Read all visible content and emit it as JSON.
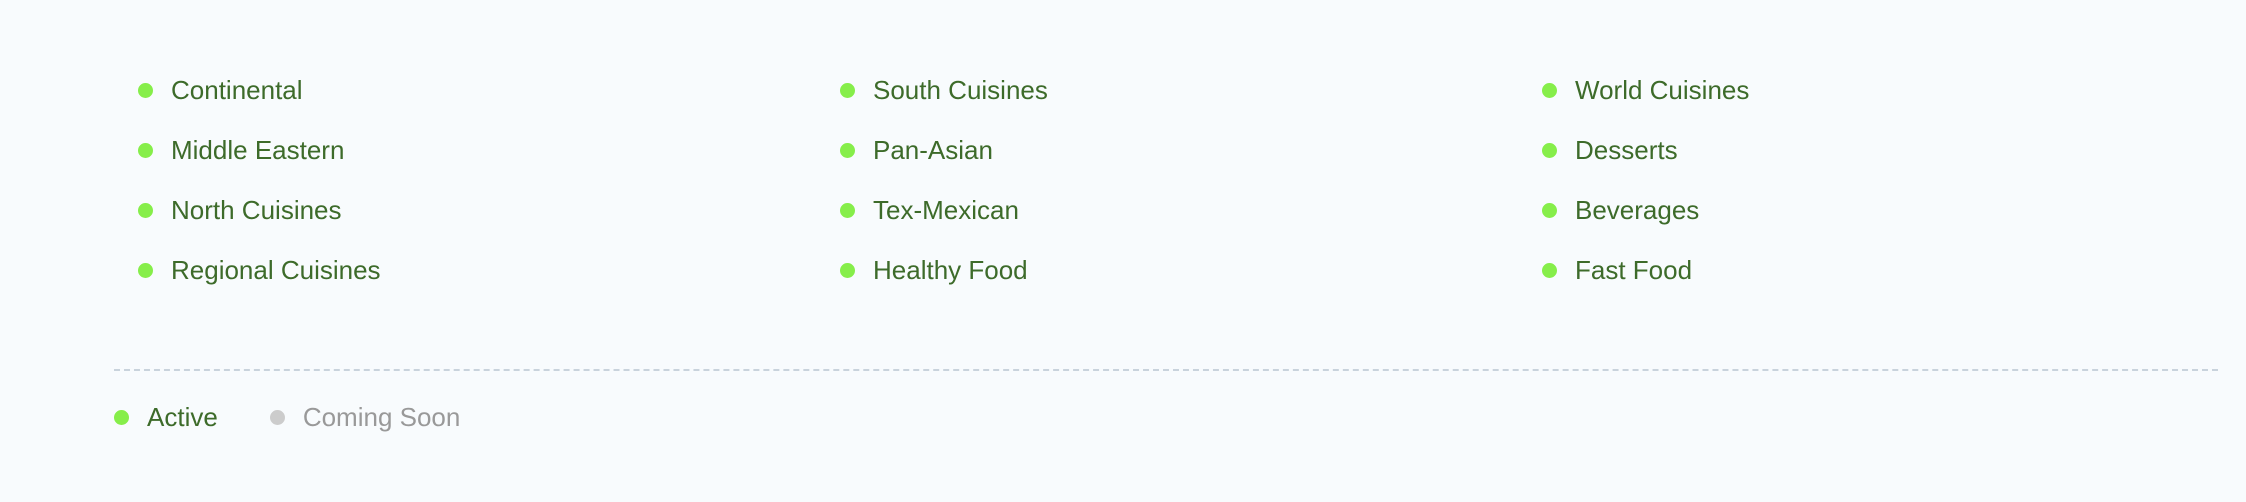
{
  "colors": {
    "active_dot": "#86ee4a",
    "coming_soon_dot": "#cccccc",
    "active_text": "#3d6b2a",
    "coming_soon_text": "#999999"
  },
  "cuisines": [
    {
      "label": "Continental",
      "status": "active"
    },
    {
      "label": "South Cuisines",
      "status": "active"
    },
    {
      "label": "World Cuisines",
      "status": "active"
    },
    {
      "label": "Middle Eastern",
      "status": "active"
    },
    {
      "label": "Pan-Asian",
      "status": "active"
    },
    {
      "label": "Desserts",
      "status": "active"
    },
    {
      "label": "North Cuisines",
      "status": "active"
    },
    {
      "label": "Tex-Mexican",
      "status": "active"
    },
    {
      "label": "Beverages",
      "status": "active"
    },
    {
      "label": "Regional Cuisines",
      "status": "active"
    },
    {
      "label": "Healthy Food",
      "status": "active"
    },
    {
      "label": "Fast Food",
      "status": "active"
    }
  ],
  "legend": {
    "active_label": "Active",
    "coming_soon_label": "Coming Soon"
  }
}
